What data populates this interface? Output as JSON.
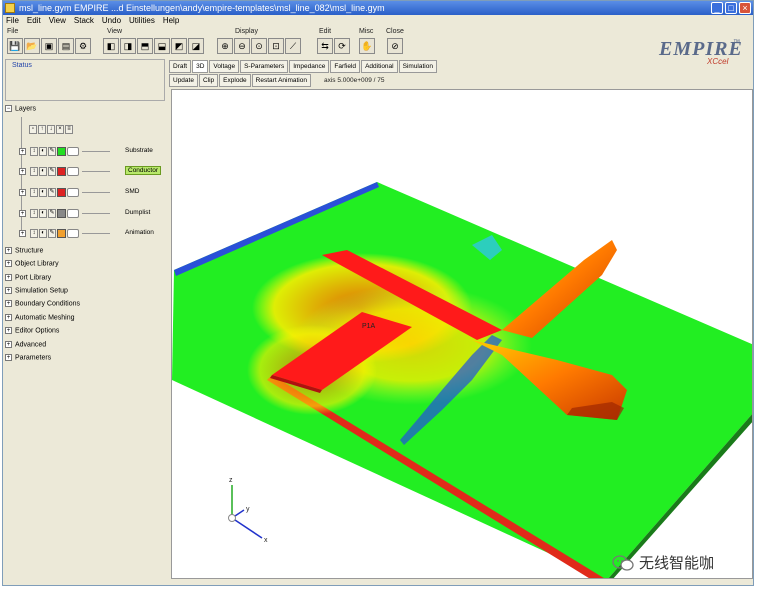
{
  "window": {
    "title": "msl_line.gym EMPIRE ...d Einstellungen\\andy\\empire-templates\\msl_line_082\\msl_line.gym",
    "controls": [
      "_",
      "□",
      "×"
    ]
  },
  "menu": [
    "File",
    "Edit",
    "View",
    "Stack",
    "Undo",
    "Utilities",
    "Help"
  ],
  "toolbar": {
    "groups": [
      "File",
      "View",
      "Display",
      "Edit",
      "Misc",
      "Close"
    ]
  },
  "logo": {
    "main": "EMPIRE",
    "tm": "™",
    "sub": "XCcel"
  },
  "status_label": "Status",
  "tabs": [
    "Draft",
    "3D",
    "Voltage",
    "S-Parameters",
    "Impedance",
    "Farfield",
    "Additional",
    "Simulation"
  ],
  "active_tab": "3D",
  "subbar": {
    "buttons": [
      "Update",
      "Clip",
      "Explode",
      "Restart Animation"
    ],
    "info": "axis 5.000e+009 / 75"
  },
  "layers_header": "Layers",
  "layers": [
    {
      "name": "Substrate",
      "color": "#22dd22",
      "selected": false
    },
    {
      "name": "Conductor",
      "color": "#dd2222",
      "selected": true
    },
    {
      "name": "SMD",
      "color": "#dd2222",
      "selected": false
    },
    {
      "name": "Dumplist",
      "color": "#888888",
      "selected": false
    },
    {
      "name": "Animation",
      "color": "#f0a030",
      "selected": false
    }
  ],
  "tree_items": [
    "Structure",
    "Object Library",
    "Port Library",
    "Simulation Setup",
    "Boundary Conditions",
    "Automatic Meshing",
    "Editor Options",
    "Advanced",
    "Parameters"
  ],
  "viewport": {
    "port_label": "P1A",
    "axes": {
      "z": "z",
      "y": "y",
      "x": "x"
    }
  },
  "watermark": "无线智能咖"
}
